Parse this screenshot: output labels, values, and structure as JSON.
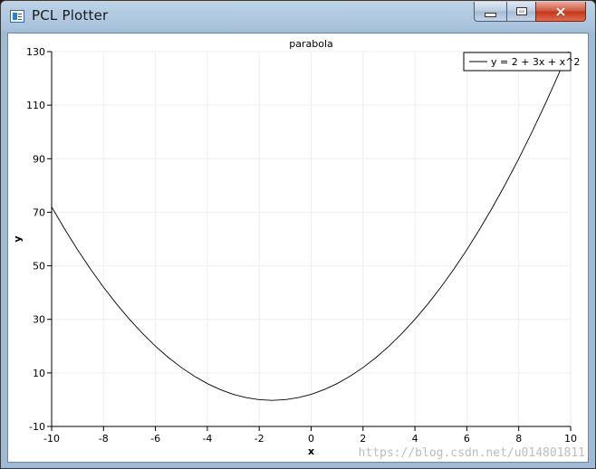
{
  "window": {
    "title": "PCL Plotter",
    "controls": {
      "minimize": "minimize",
      "maximize": "maximize",
      "close": "×"
    }
  },
  "watermark": "https://blog.csdn.net/u014801811",
  "chart_data": {
    "type": "line",
    "title": "parabola",
    "xlabel": "x",
    "ylabel": "y",
    "xlim": [
      -10,
      10
    ],
    "ylim": [
      -10,
      130
    ],
    "xticks": [
      -10,
      -8,
      -6,
      -4,
      -2,
      0,
      2,
      4,
      6,
      8,
      10
    ],
    "yticks": [
      -10,
      10,
      30,
      50,
      70,
      90,
      110,
      130
    ],
    "grid": true,
    "legend_placement": "top-right",
    "series": [
      {
        "name": "y = 2 + 3x + x^2",
        "color": "#000000",
        "x": [
          -10,
          -9.5,
          -9,
          -8.5,
          -8,
          -7.5,
          -7,
          -6.5,
          -6,
          -5.5,
          -5,
          -4.5,
          -4,
          -3.5,
          -3,
          -2.5,
          -2,
          -1.5,
          -1,
          -0.5,
          0,
          0.5,
          1,
          1.5,
          2,
          2.5,
          3,
          3.5,
          4,
          4.5,
          5,
          5.5,
          6,
          6.5,
          7,
          7.5,
          8,
          8.5,
          9,
          9.5,
          10
        ],
        "y": [
          72,
          63.75,
          56,
          48.75,
          42,
          35.75,
          30,
          24.75,
          20,
          15.75,
          12,
          8.75,
          6,
          3.75,
          2,
          0.75,
          0,
          -0.25,
          0,
          0.75,
          2,
          3.75,
          6,
          8.75,
          12,
          15.75,
          20,
          24.75,
          30,
          35.75,
          42,
          48.75,
          56,
          63.75,
          72,
          80.75,
          90,
          99.75,
          110,
          120.75,
          132
        ]
      }
    ]
  }
}
